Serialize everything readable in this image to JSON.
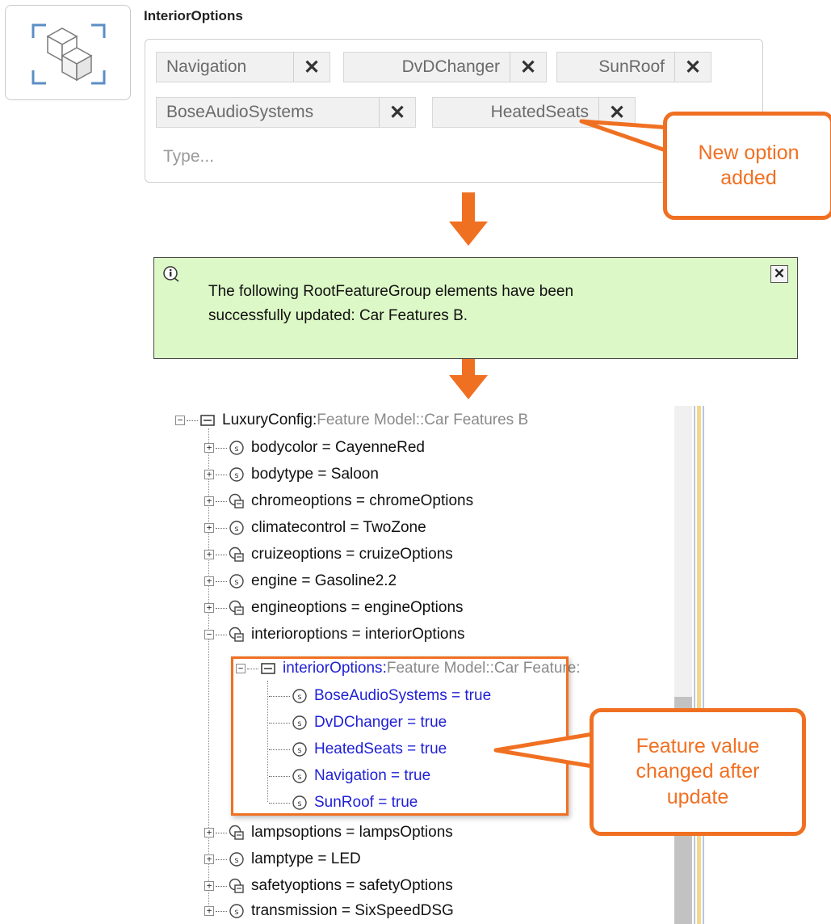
{
  "field": {
    "label": "InteriorOptions",
    "tags": [
      {
        "text": "Navigation",
        "remove": "✕"
      },
      {
        "text": "DvDChanger",
        "remove": "✕"
      },
      {
        "text": "SunRoof",
        "remove": "✕"
      },
      {
        "text": "BoseAudioSystems",
        "remove": "✕"
      },
      {
        "text": "HeatedSeats",
        "remove": "✕"
      }
    ],
    "placeholder": "Type..."
  },
  "callouts": {
    "top": "New option\nadded",
    "bottom": "Feature value\nchanged after\nupdate"
  },
  "notification": {
    "message_line1": "The following RootFeatureGroup elements have been",
    "message_line2": "successfully updated: Car Features B.",
    "close": "✕"
  },
  "tree": {
    "root": {
      "name": "LuxuryConfig",
      "sep": " : ",
      "type": "Feature Model::Car Features B"
    },
    "items": [
      {
        "label": "bodycolor = CayenneRed",
        "icon": "slot-icon"
      },
      {
        "label": "bodytype = Saloon",
        "icon": "slot-icon"
      },
      {
        "label": "chromeoptions = chromeOptions",
        "icon": "group-slot-icon"
      },
      {
        "label": "climatecontrol = TwoZone",
        "icon": "slot-icon"
      },
      {
        "label": "cruizeoptions = cruizeOptions",
        "icon": "group-slot-icon"
      },
      {
        "label": "engine = Gasoline2.2",
        "icon": "slot-icon"
      },
      {
        "label": "engineoptions = engineOptions",
        "icon": "group-slot-icon"
      },
      {
        "label": "interioroptions = interiorOptions",
        "icon": "group-slot-icon"
      }
    ],
    "sub_root": {
      "name": "interiorOptions",
      "sep": " : ",
      "type": "Feature Model::Car Feature:"
    },
    "sub_items": [
      "BoseAudioSystems = true",
      "DvDChanger = true",
      "HeatedSeats = true",
      "Navigation = true",
      "SunRoof = true"
    ],
    "items_after": [
      {
        "label": "lampsoptions = lampsOptions",
        "icon": "group-slot-icon"
      },
      {
        "label": "lamptype = LED",
        "icon": "slot-icon"
      },
      {
        "label": "safetyoptions = safetyOptions",
        "icon": "group-slot-icon"
      },
      {
        "label": "transmission = SixSpeedDSG",
        "icon": "slot-icon"
      }
    ]
  },
  "colors": {
    "accent": "#f07022",
    "notification_bg": "#dcf8c6",
    "changed_text": "#1f1fd6"
  }
}
